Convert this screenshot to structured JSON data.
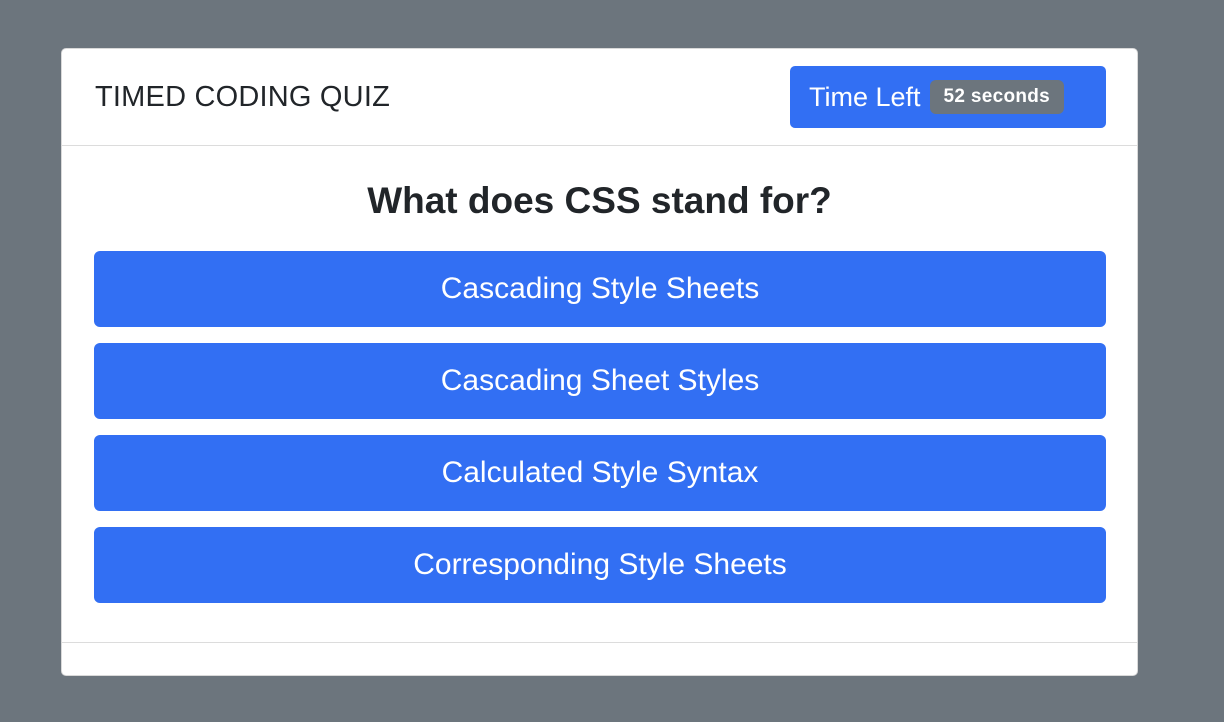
{
  "header": {
    "title": "TIMED CODING QUIZ",
    "timer_label": "Time Left",
    "timer_value": "52 seconds"
  },
  "quiz": {
    "question": "What does CSS stand for?",
    "answers": [
      "Cascading Style Sheets",
      "Cascading Sheet Styles",
      "Calculated Style Syntax",
      "Corresponding Style Sheets"
    ]
  },
  "colors": {
    "background": "#6c757d",
    "primary": "#326ff3",
    "badge": "#6c757d"
  }
}
